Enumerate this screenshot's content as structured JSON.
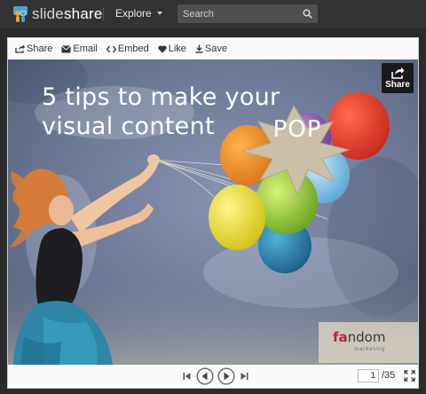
{
  "topbar": {
    "logo_prefix": "slide",
    "logo_suffix": "share",
    "explore_label": "Explore",
    "search_placeholder": "Search"
  },
  "toolbar": {
    "share_label": "Share",
    "email_label": "Email",
    "embed_label": "Embed",
    "like_label": "Like",
    "save_label": "Save"
  },
  "slide": {
    "title_line1": "5 tips to make your",
    "title_line2": "visual content",
    "pop_label": "POP",
    "share_badge_label": "Share",
    "brand_name_rest": "ndom",
    "brand_name_first": "fa",
    "brand_sub": "marketing"
  },
  "controls": {
    "current_page": "1",
    "total_pages": "/35"
  },
  "colors": {
    "topbar_bg": "#333333",
    "accent_brand": "#b02a35",
    "slide_sky": "#6c7895"
  }
}
